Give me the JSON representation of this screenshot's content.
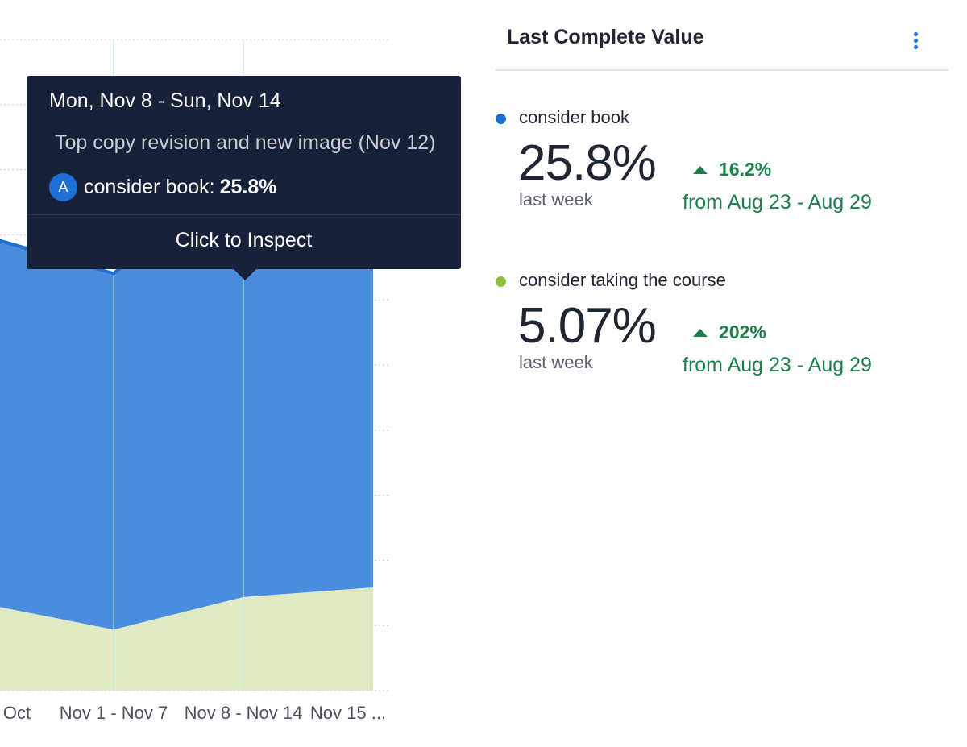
{
  "chart_data": {
    "type": "area",
    "x": [
      "Oct",
      "Nov 1 - Nov 7",
      "Nov 8 - Nov 14",
      "Nov 15 ..."
    ],
    "series": [
      {
        "name": "consider book",
        "values": [
          22.4,
          20.5,
          25.8,
          21.5
        ]
      },
      {
        "name": "consider taking the course",
        "values": [
          4.3,
          3.0,
          4.6,
          5.07
        ]
      }
    ],
    "colors": {
      "consider book": "#4a8ddf",
      "consider taking the course": "#dfeac4"
    },
    "stroke_color": "#1d6fd6"
  },
  "tooltip": {
    "date": "Mon, Nov 8 - Sun, Nov 14",
    "annotation": "Top copy revision and new image (Nov 12)",
    "badge": "A",
    "series_label": "consider book:",
    "series_value": "25.8%",
    "action": "Click to Inspect"
  },
  "panel": {
    "title": "Last Complete Value",
    "metrics": [
      {
        "label": "consider book",
        "value": "25.8%",
        "period": "last week",
        "change": "16.2%",
        "from": "from Aug 23 - Aug 29",
        "color": "#1d6fd6"
      },
      {
        "label": "consider taking the course",
        "value": "5.07%",
        "period": "last week",
        "change": "202%",
        "from": "from Aug 23 - Aug 29",
        "color": "#8fbf3f"
      }
    ]
  }
}
